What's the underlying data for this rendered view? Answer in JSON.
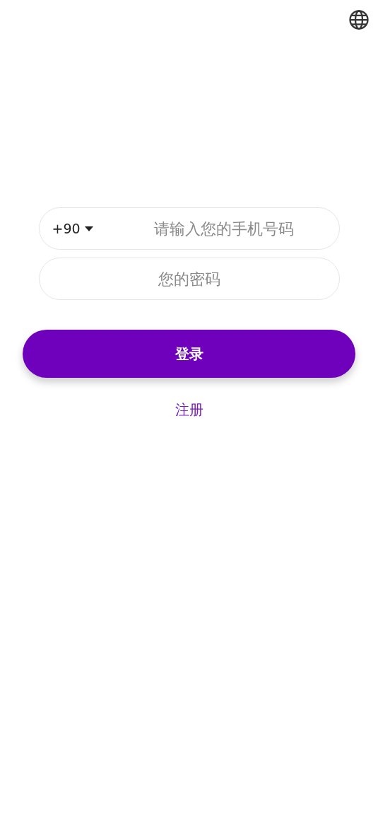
{
  "phone_field": {
    "country_code": "+90",
    "placeholder": "请输入您的手机号码"
  },
  "password_field": {
    "placeholder": "您的密码"
  },
  "login_button": {
    "label": "登录"
  },
  "register_link": {
    "label": "注册"
  }
}
